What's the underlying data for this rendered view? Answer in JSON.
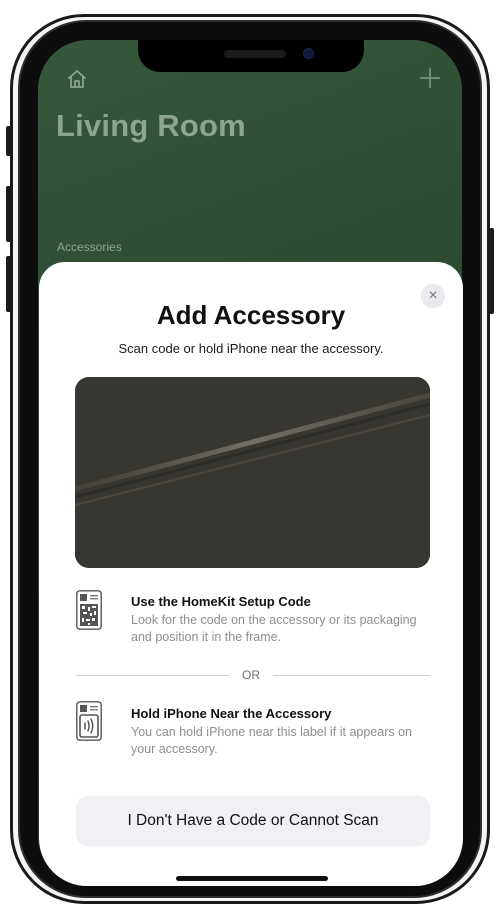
{
  "backdrop": {
    "room_title": "Living Room",
    "section_label": "Accessories",
    "home_icon": "home-icon",
    "add_icon": "plus-icon"
  },
  "sheet": {
    "title": "Add Accessory",
    "subtitle": "Scan code or hold iPhone near the accessory.",
    "close_label": "×",
    "options": [
      {
        "icon": "qr-code-icon",
        "title": "Use the HomeKit Setup Code",
        "description": "Look for the code on the accessory or its packaging and position it in the frame."
      },
      {
        "icon": "nfc-tag-icon",
        "title": "Hold iPhone Near the Accessory",
        "description": "You can hold iPhone near this label if it appears on your accessory."
      }
    ],
    "divider_text": "OR",
    "no_code_button": "I Don't Have a Code or Cannot Scan"
  },
  "colors": {
    "wallpaper": "#2b4a31",
    "sheet_bg": "#ffffff",
    "button_bg": "#f0f0f5",
    "secondary_text": "#8e8e93"
  }
}
